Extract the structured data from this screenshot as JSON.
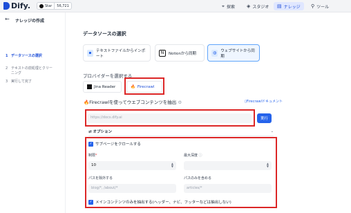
{
  "app": {
    "name": "Dify.",
    "star_label": "Star",
    "star_count": "56,721"
  },
  "nav": {
    "explore": "探索",
    "studio": "スタジオ",
    "knowledge": "ナレッジ",
    "tools": "ツール"
  },
  "sidebar": {
    "back_icon": "←",
    "title": "ナレッジの作成",
    "steps": [
      {
        "num": "1",
        "label": "データソースの選択"
      },
      {
        "num": "2",
        "label": "テキストの前処理とクリーニング"
      },
      {
        "num": "3",
        "label": "実行して完了"
      }
    ]
  },
  "main": {
    "heading": "データソースの選択",
    "sources": [
      {
        "label": "テキストファイルからインポート",
        "icon": "file-icon"
      },
      {
        "label": "Notionから同期",
        "icon": "notion-icon"
      },
      {
        "label": "ウェブサイトから同期",
        "icon": "globe-icon"
      }
    ],
    "provider_heading": "プロバイダーを選択する",
    "providers": [
      {
        "label": "Jina Reader"
      },
      {
        "label": "Firecrawl"
      }
    ],
    "firecrawl_title": "Firecrawlを使ってウエブコンテンツを抽出",
    "doc_link": "Firecrawlドキュメント",
    "url_placeholder": "https://docs.dify.ai",
    "run_label": "実行",
    "options_label": "オプション",
    "crawl_sub": "サブページをクロールする",
    "limit_label": "制限",
    "limit_value": "10",
    "depth_label": "最大深度",
    "exclude_label": "パスを除外する",
    "exclude_placeholder": "blog/*, /about/*",
    "include_label": "パスのみを含める",
    "include_placeholder": "articles/*",
    "main_only": "メインコンテンツのみを抽出する(ヘッダー、ナビ、フッターなどは抽出しない)"
  },
  "colors": {
    "accent": "#2563eb",
    "highlight": "#dc2626"
  }
}
